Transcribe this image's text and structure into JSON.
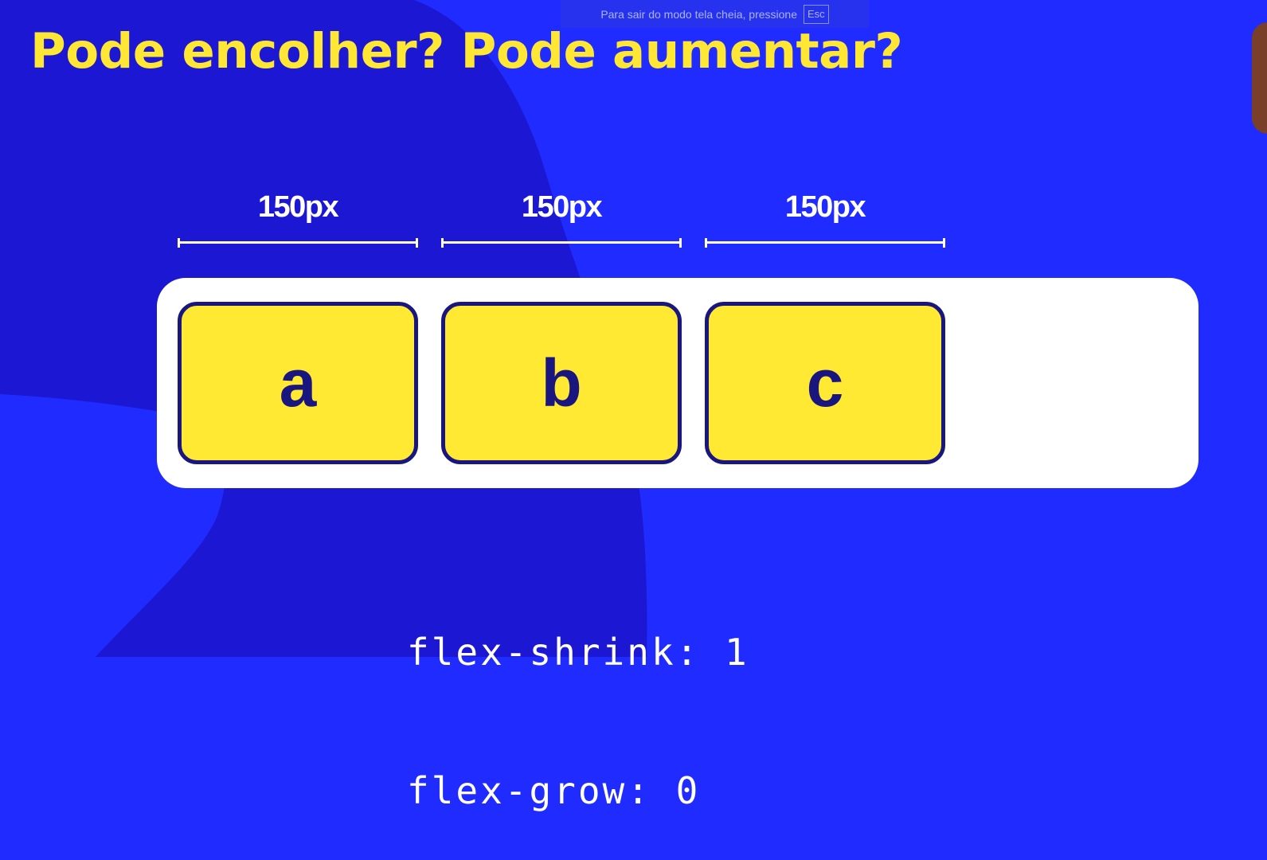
{
  "colors": {
    "background": "#1f2bff",
    "blob": "#1b17d2",
    "title": "#ffe733",
    "item_fill": "#ffe933",
    "item_border": "#1a1680",
    "container": "#ffffff"
  },
  "fullscreen_notice": {
    "text": "Para sair do modo tela cheia, pressione",
    "key": "Esc"
  },
  "slide": {
    "title": "Pode encolher? Pode aumentar?",
    "measures": [
      {
        "label": "150px"
      },
      {
        "label": "150px"
      },
      {
        "label": "150px"
      }
    ],
    "items": [
      {
        "label": "a"
      },
      {
        "label": "b"
      },
      {
        "label": "c"
      }
    ],
    "code": {
      "line1": "flex-shrink: 1",
      "line2": "flex-grow: 0"
    }
  }
}
